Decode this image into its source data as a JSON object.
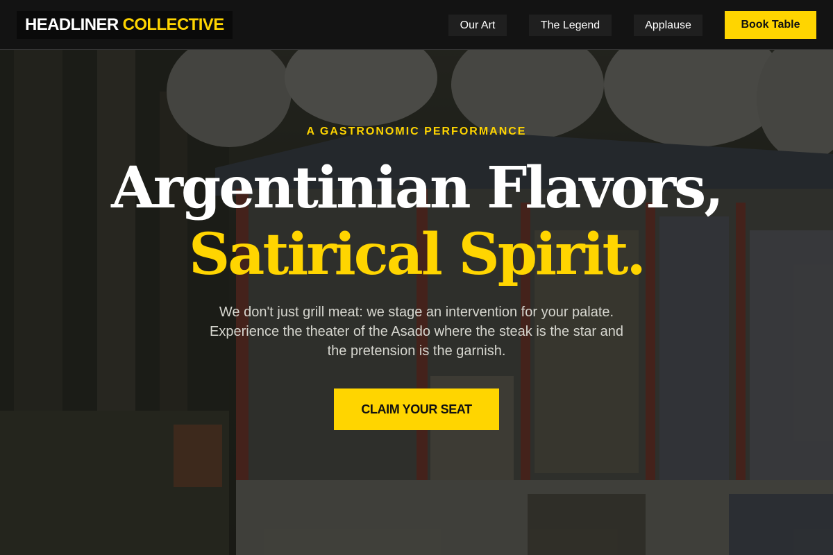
{
  "brand": {
    "name_part1": "HEADLINER",
    "name_part2": "COLLECTIVE"
  },
  "nav": {
    "links": [
      {
        "label": "Our Art"
      },
      {
        "label": "The Legend"
      },
      {
        "label": "Applause"
      }
    ],
    "book_label": "Book Table"
  },
  "hero": {
    "eyebrow": "A GASTRONOMIC PERFORMANCE",
    "headline_line1": "Argentinian Flavors,",
    "headline_line2": "Satirical Spirit.",
    "subtitle_lines": [
      "We don't just grill meat: we stage an intervention for your palate.",
      "Experience the theater of the Asado where the steak is the star and",
      "the pretension is the garnish."
    ],
    "cta_label": "CLAIM YOUR SEAT"
  },
  "colors": {
    "accent": "#ffd500",
    "nav_background": "#131313",
    "text": "#ffffff"
  }
}
